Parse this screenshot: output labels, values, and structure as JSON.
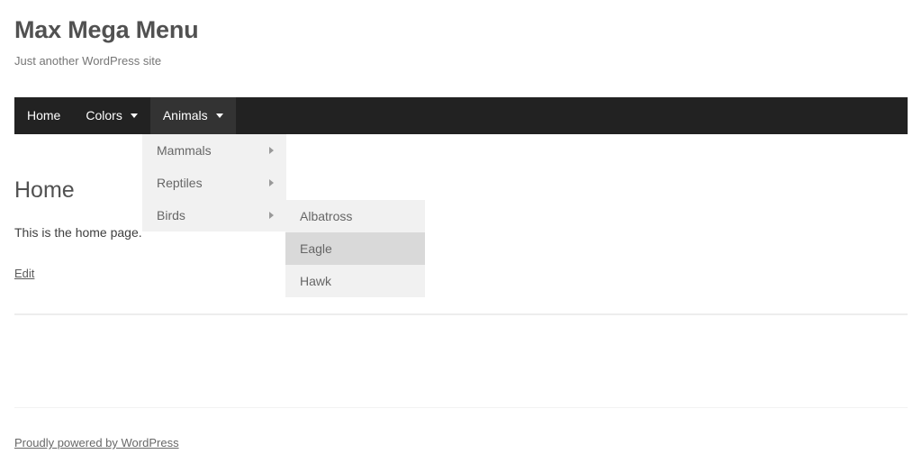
{
  "site": {
    "title": "Max Mega Menu",
    "tagline": "Just another WordPress site"
  },
  "nav": {
    "items": [
      {
        "label": "Home",
        "has_dropdown": false,
        "active": false
      },
      {
        "label": "Colors",
        "has_dropdown": true,
        "active": false
      },
      {
        "label": "Animals",
        "has_dropdown": true,
        "active": true
      }
    ],
    "dropdown_icon": "caret-down-icon"
  },
  "submenu_animals": {
    "parent": "Animals",
    "items": [
      {
        "label": "Mammals",
        "has_flyout": true,
        "hovered": false
      },
      {
        "label": "Reptiles",
        "has_flyout": true,
        "hovered": false
      },
      {
        "label": "Birds",
        "has_flyout": true,
        "hovered": false
      }
    ],
    "flyout_icon": "caret-right-icon"
  },
  "submenu_birds": {
    "parent": "Birds",
    "items": [
      {
        "label": "Albatross",
        "hovered": false
      },
      {
        "label": "Eagle",
        "hovered": true
      },
      {
        "label": "Hawk",
        "hovered": false
      }
    ]
  },
  "content": {
    "heading": "Home",
    "paragraph": "This is the home page.",
    "edit_link": "Edit"
  },
  "footer": {
    "credit_link": "Proudly powered by WordPress"
  },
  "colors": {
    "nav_background": "#222222",
    "nav_active_background": "#333333",
    "nav_text": "#ffffff",
    "panel_background": "#f1f1f1",
    "panel_hover_background": "#d9d9d9",
    "panel_text": "#666666",
    "title_text": "#515151",
    "tagline_text": "#767676",
    "divider": "#ededed",
    "page_background": "#ffffff"
  }
}
